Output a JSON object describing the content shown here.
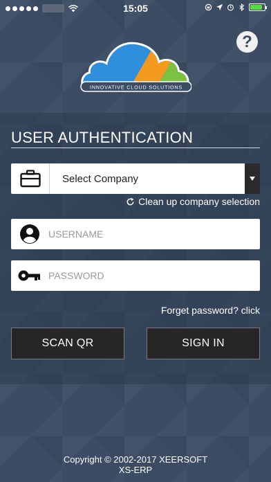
{
  "status_bar": {
    "time": "15:05",
    "battery_level": 0.85,
    "battery_color": "#5ad93a"
  },
  "help": {
    "label": "?"
  },
  "logo": {
    "tagline": "INNOVATIVE CLOUD SOLUTIONS"
  },
  "auth": {
    "title": "USER AUTHENTICATION",
    "company_select": {
      "selected": "Select Company",
      "icon": "briefcase-icon"
    },
    "cleanup_label": "Clean up company selection",
    "username": {
      "placeholder": "USERNAME",
      "value": "",
      "icon": "user-icon"
    },
    "password": {
      "placeholder": "PASSWORD",
      "value": "",
      "icon": "key-icon"
    },
    "forget_label": "Forget password? click",
    "scan_qr_label": "SCAN QR",
    "sign_in_label": "SIGN IN"
  },
  "footer": {
    "copyright": "Copyright © 2002-2017 XEERSOFT",
    "product": "XS-ERP"
  },
  "colors": {
    "background": "#3b4c63",
    "button": "#262626",
    "logo_blue": "#2f8fdc",
    "logo_orange": "#f39a1e",
    "logo_green": "#7dc142"
  }
}
